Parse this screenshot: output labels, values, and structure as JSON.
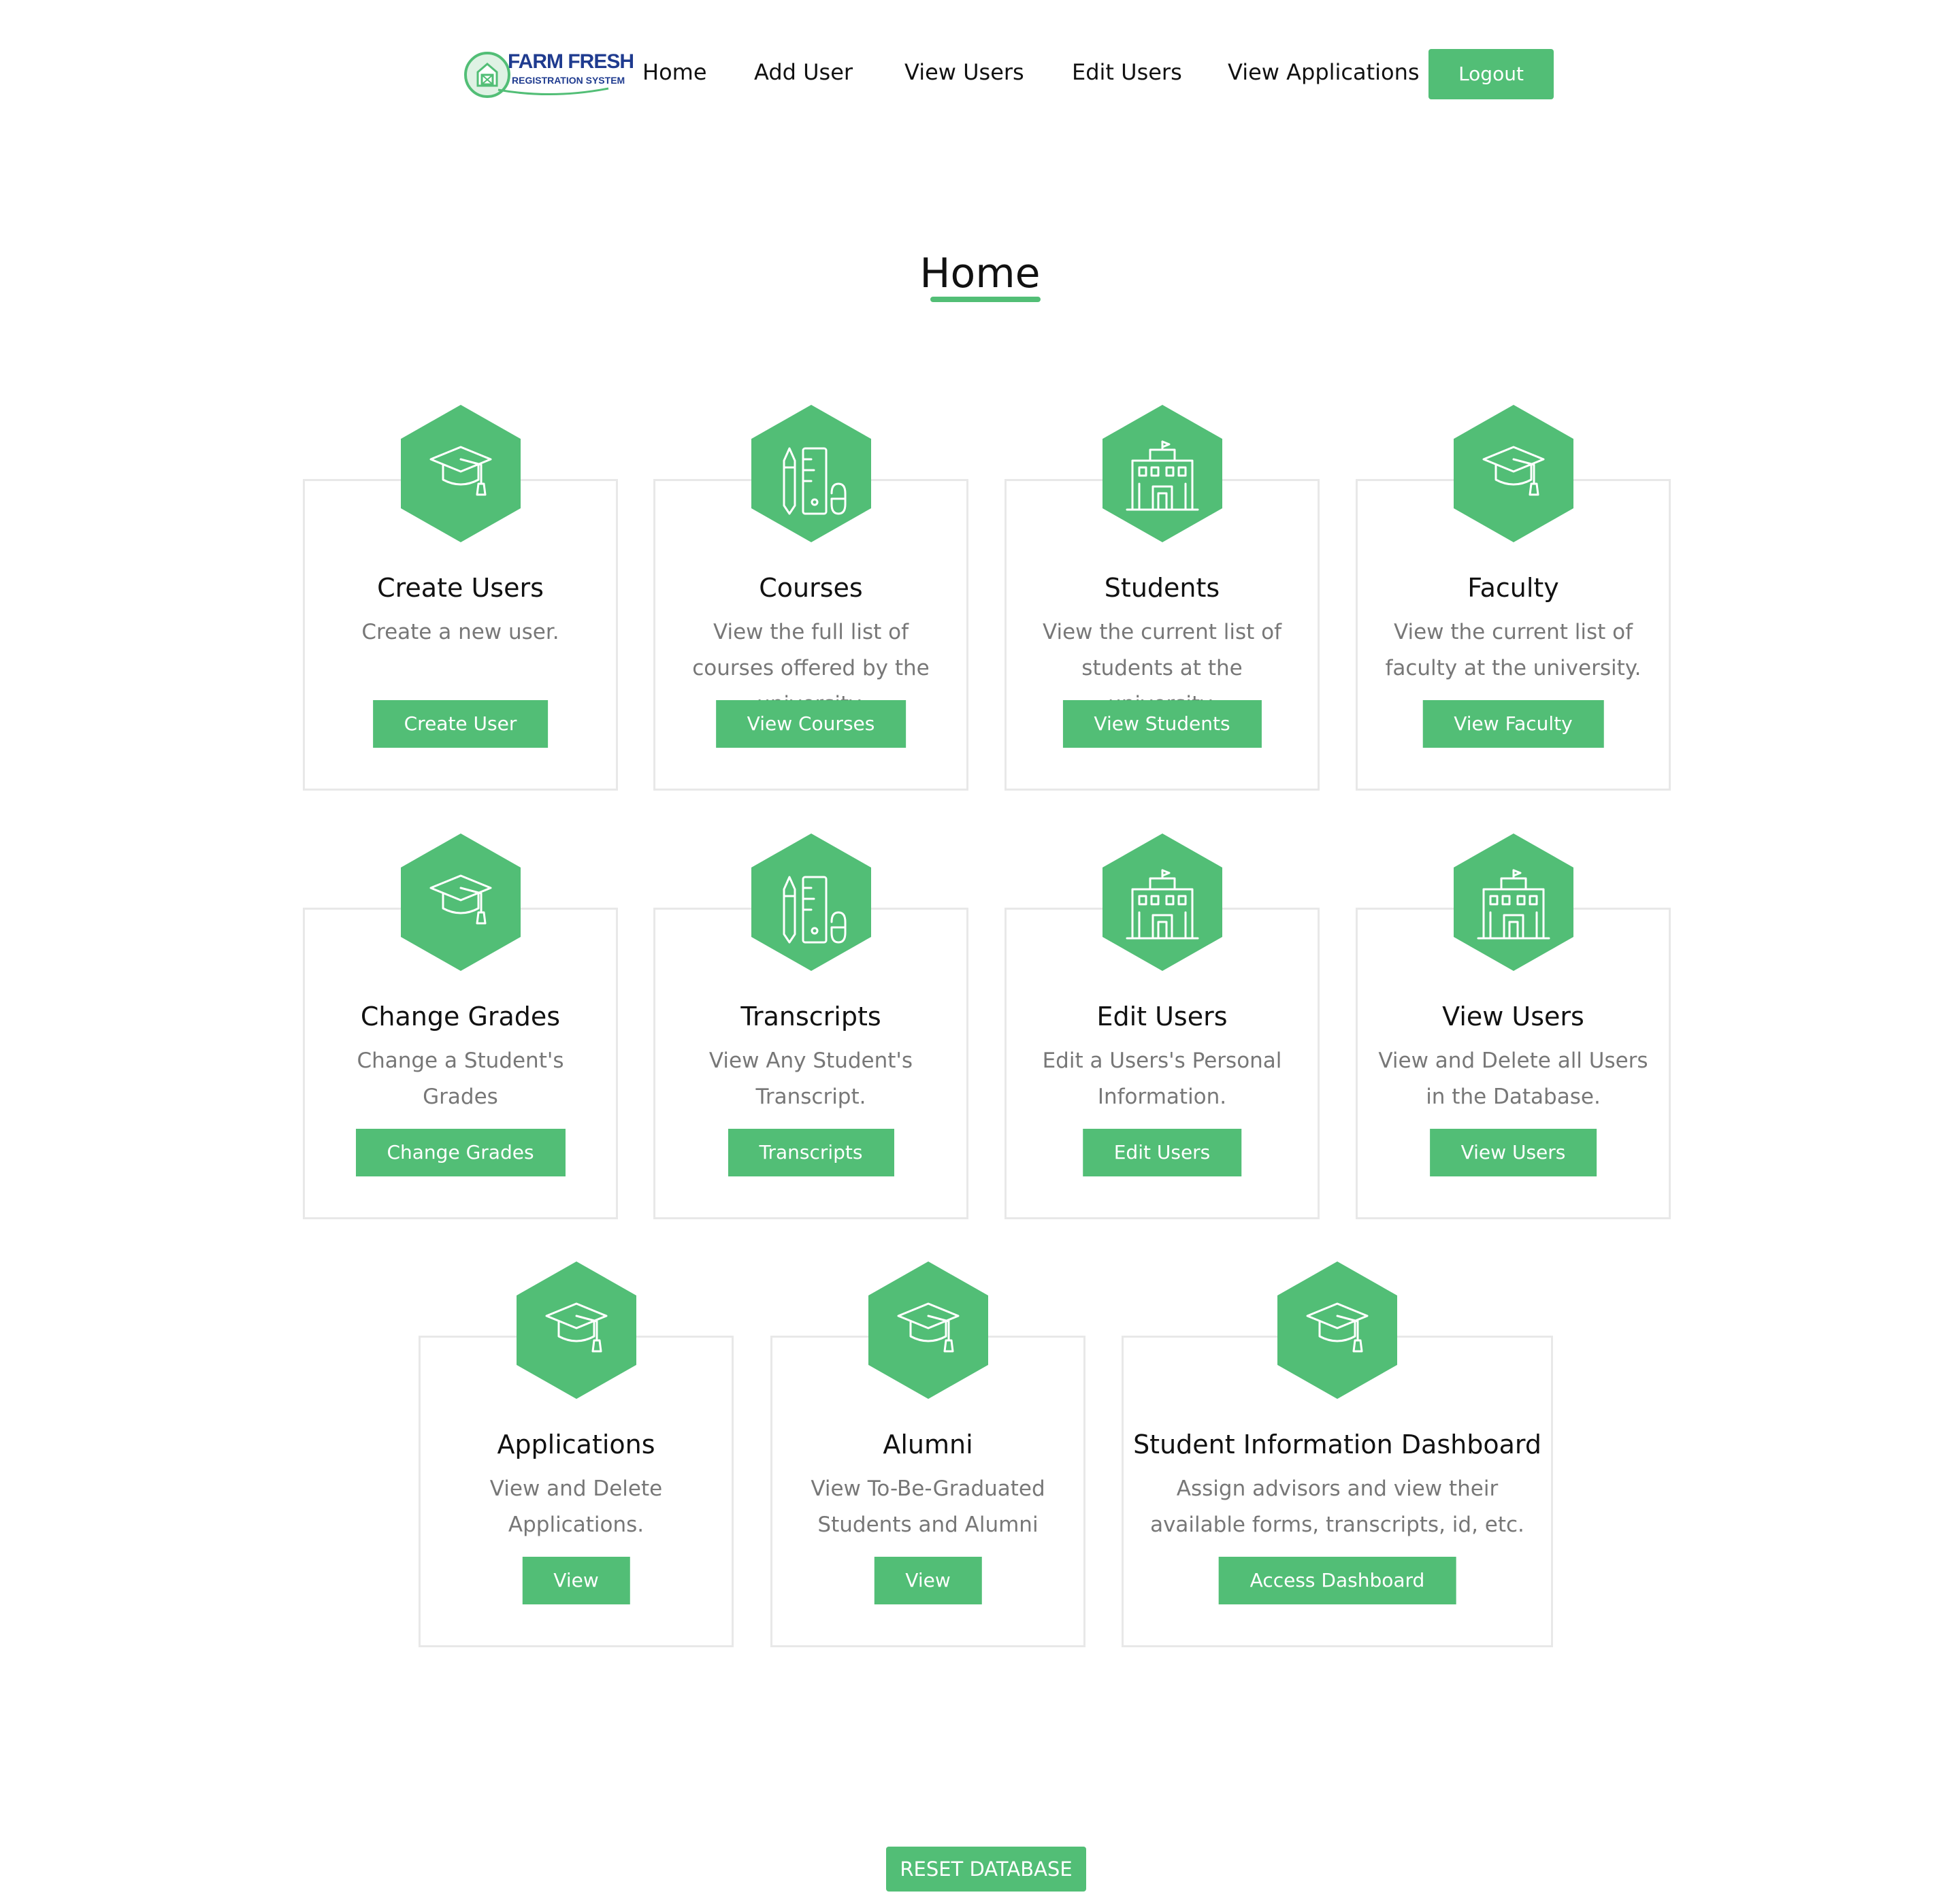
{
  "brand": {
    "logo_line1": "FARM FRESH",
    "logo_line2": "REGISTRATION SYSTEM",
    "accent_color": "#52be76"
  },
  "nav": {
    "links": [
      "Home",
      "Add User",
      "View Users",
      "Edit Users",
      "View Applications"
    ],
    "logout_label": "Logout"
  },
  "page": {
    "title": "Home"
  },
  "cards": [
    {
      "icon": "graduation-cap-icon",
      "title": "Create Users",
      "desc": "Create a new user.",
      "button": "Create User"
    },
    {
      "icon": "pencil-ruler-icon",
      "title": "Courses",
      "desc": "View the full list of courses offered by the university.",
      "button": "View Courses"
    },
    {
      "icon": "school-building-icon",
      "title": "Students",
      "desc": "View the current list of students at the university.",
      "button": "View Students"
    },
    {
      "icon": "graduation-cap-icon",
      "title": "Faculty",
      "desc": "View the current list of faculty at the university.",
      "button": "View Faculty"
    },
    {
      "icon": "graduation-cap-icon",
      "title": "Change Grades",
      "desc": "Change a Student's Grades",
      "button": "Change Grades"
    },
    {
      "icon": "pencil-ruler-icon",
      "title": "Transcripts",
      "desc": "View Any Student's Transcript.",
      "button": "Transcripts"
    },
    {
      "icon": "school-building-icon",
      "title": "Edit Users",
      "desc": "Edit a Users's Personal Information.",
      "button": "Edit Users"
    },
    {
      "icon": "school-building-icon",
      "title": "View Users",
      "desc": "View and Delete all Users in the Database.",
      "button": "View Users"
    },
    {
      "icon": "graduation-cap-icon",
      "title": "Applications",
      "desc": "View and Delete Applications.",
      "button": "View"
    },
    {
      "icon": "graduation-cap-icon",
      "title": "Alumni",
      "desc": "View To-Be-Graduated Students and Alumni",
      "button": "View"
    },
    {
      "icon": "graduation-cap-icon",
      "title": "Student Information Dashboard",
      "desc": "Assign advisors and view their available forms, transcripts, id, etc.",
      "button": "Access Dashboard"
    }
  ],
  "footer": {
    "reset_label": "RESET DATABASE"
  }
}
